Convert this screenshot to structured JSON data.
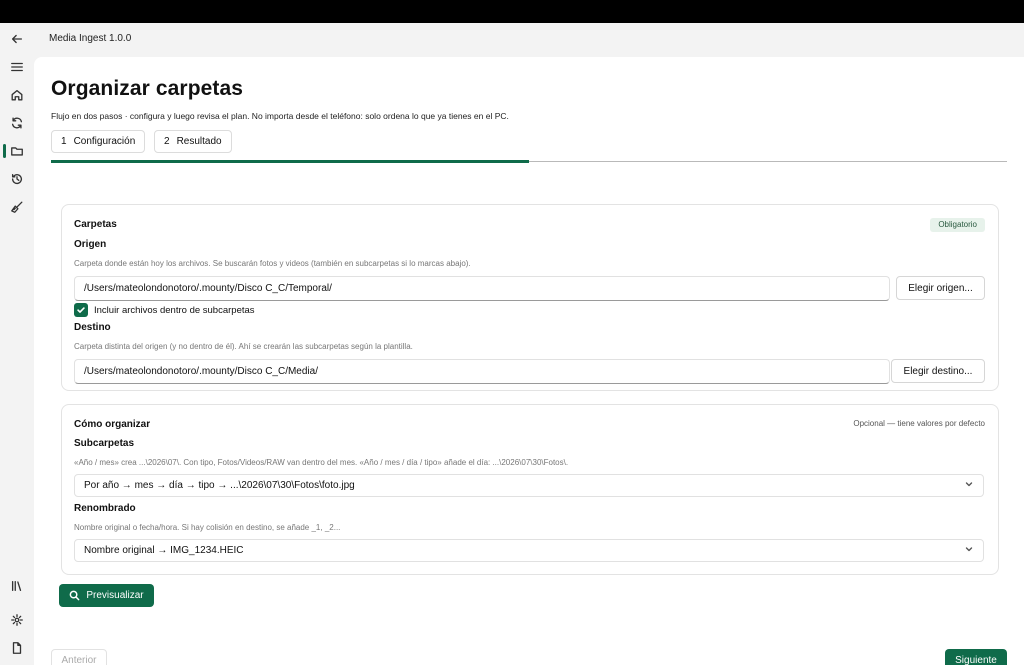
{
  "window": {
    "title": "Media Ingest 1.0.0"
  },
  "rail": {
    "icons": [
      "back-arrow-icon",
      "menu-icon",
      "home-icon",
      "sync-icon",
      "folder-icon",
      "history-icon",
      "broom-icon",
      "library-icon",
      "settings-icon",
      "file-icon"
    ],
    "active": "folder-icon"
  },
  "page": {
    "title": "Organizar carpetas",
    "subtitle": "Flujo en dos pasos · configura y luego revisa el plan. No importa desde el teléfono: solo ordena lo que ya tienes en el PC."
  },
  "steps": [
    {
      "num": "1",
      "label": "Configuración",
      "active": true
    },
    {
      "num": "2",
      "label": "Resultado",
      "active": false
    }
  ],
  "progress": {
    "fraction": 0.5
  },
  "folders_card": {
    "title": "Carpetas",
    "badge": "Obligatorio",
    "origin": {
      "label": "Origen",
      "help": "Carpeta donde están hoy los archivos. Se buscarán fotos y videos (también en subcarpetas si lo marcas abajo).",
      "value": "/Users/mateolondonotoro/.mounty/Disco C_C/Temporal/",
      "button": "Elegir origen..."
    },
    "include_subfolders": {
      "label": "Incluir archivos dentro de subcarpetas",
      "checked": true
    },
    "destination": {
      "label": "Destino",
      "help": "Carpeta distinta del origen (y no dentro de él). Ahí se crearán las subcarpetas según la plantilla.",
      "value": "/Users/mateolondonotoro/.mounty/Disco C_C/Media/",
      "button": "Elegir destino..."
    }
  },
  "organize_card": {
    "title": "Cómo organizar",
    "badge": "Opcional — tiene valores por defecto",
    "subfolders": {
      "label": "Subcarpetas",
      "help": "«Año / mes» crea ...\\2026\\07\\. Con tipo, Fotos/Videos/RAW van dentro del mes. «Año / mes / día / tipo» añade el día: ...\\2026\\07\\30\\Fotos\\.",
      "selected": "Por año → mes → día → tipo → ...\\2026\\07\\30\\Fotos\\foto.jpg"
    },
    "rename": {
      "label": "Renombrado",
      "help": "Nombre original o fecha/hora. Si hay colisión en destino, se añade _1, _2...",
      "selected": "Nombre original → IMG_1234.HEIC"
    }
  },
  "actions": {
    "preview": "Previsualizar",
    "previous": "Anterior",
    "next": "Siguiente"
  },
  "colors": {
    "accent": "#0f6b4a",
    "badge_bg": "#e7f2eb"
  }
}
